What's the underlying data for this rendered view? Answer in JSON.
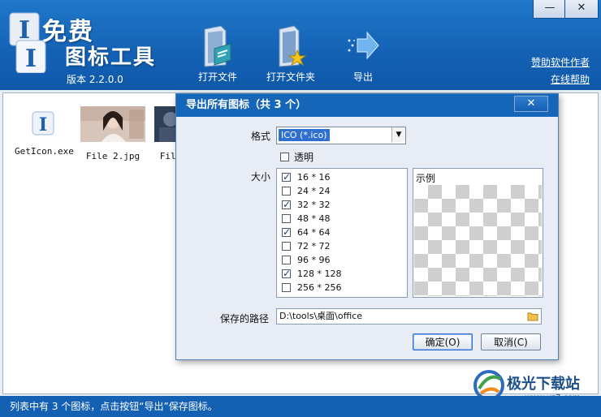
{
  "app": {
    "title_line1": "免费",
    "title_line2": "图标工具",
    "version": "版本 2.2.0.0"
  },
  "toolbar": {
    "open_file": "打开文件",
    "open_folder": "打开文件夹",
    "export": "导出"
  },
  "window_controls": {
    "minimize": "—",
    "close": "✕"
  },
  "links": {
    "sponsor": "赞助软件作者",
    "help": "在线帮助"
  },
  "files": [
    {
      "name": "GetIcon.exe",
      "icon": "app-icon"
    },
    {
      "name": "File 2.jpg",
      "icon": "photo-thumbnail"
    },
    {
      "name": "File",
      "icon": "photo-thumbnail"
    }
  ],
  "dialog": {
    "title": "导出所有图标（共 3 个）",
    "close": "✕",
    "format_label": "格式",
    "format_value": "ICO (*.ico)",
    "transparent_label": "透明",
    "transparent_checked": false,
    "size_label": "大小",
    "sizes": [
      {
        "label": "16 * 16",
        "checked": true
      },
      {
        "label": "24 * 24",
        "checked": false
      },
      {
        "label": "32 * 32",
        "checked": true
      },
      {
        "label": "48 * 48",
        "checked": false
      },
      {
        "label": "64 * 64",
        "checked": true
      },
      {
        "label": "72 * 72",
        "checked": false
      },
      {
        "label": "96 * 96",
        "checked": false
      },
      {
        "label": "128 * 128",
        "checked": true
      },
      {
        "label": "256 * 256",
        "checked": false
      }
    ],
    "preview_label": "示例",
    "path_label": "保存的路径",
    "path_value": "D:\\tools\\桌面\\office",
    "ok": "确定(O)",
    "cancel": "取消(C)"
  },
  "status": "列表中有 3 个图标，点击按钮“导出”保存图标。",
  "watermark": {
    "text": "极光下载站",
    "url": "www.xz7.com"
  },
  "colors": {
    "header": "#1461b4",
    "title_bar": "#1565b8",
    "accent": "#2f6fd0"
  }
}
